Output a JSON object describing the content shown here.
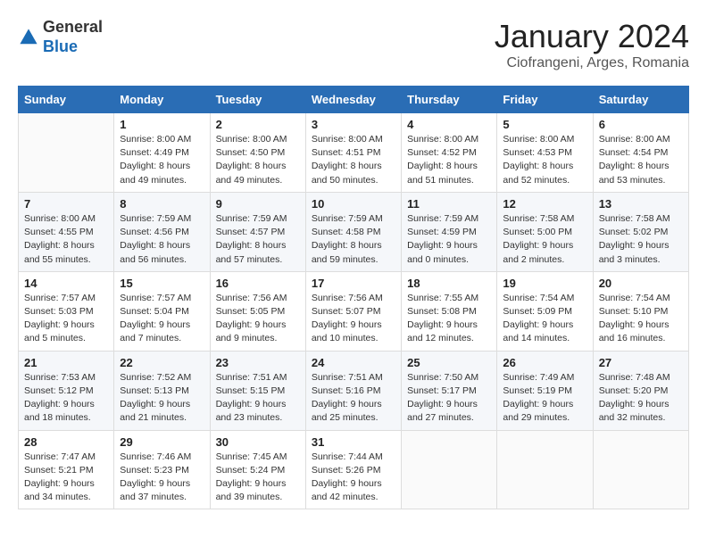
{
  "header": {
    "logo": {
      "general": "General",
      "blue": "Blue"
    },
    "title": "January 2024",
    "subtitle": "Ciofrangeni, Arges, Romania"
  },
  "days_of_week": [
    "Sunday",
    "Monday",
    "Tuesday",
    "Wednesday",
    "Thursday",
    "Friday",
    "Saturday"
  ],
  "weeks": [
    [
      {
        "day": "",
        "info": ""
      },
      {
        "day": "1",
        "info": "Sunrise: 8:00 AM\nSunset: 4:49 PM\nDaylight: 8 hours\nand 49 minutes."
      },
      {
        "day": "2",
        "info": "Sunrise: 8:00 AM\nSunset: 4:50 PM\nDaylight: 8 hours\nand 49 minutes."
      },
      {
        "day": "3",
        "info": "Sunrise: 8:00 AM\nSunset: 4:51 PM\nDaylight: 8 hours\nand 50 minutes."
      },
      {
        "day": "4",
        "info": "Sunrise: 8:00 AM\nSunset: 4:52 PM\nDaylight: 8 hours\nand 51 minutes."
      },
      {
        "day": "5",
        "info": "Sunrise: 8:00 AM\nSunset: 4:53 PM\nDaylight: 8 hours\nand 52 minutes."
      },
      {
        "day": "6",
        "info": "Sunrise: 8:00 AM\nSunset: 4:54 PM\nDaylight: 8 hours\nand 53 minutes."
      }
    ],
    [
      {
        "day": "7",
        "info": "Sunrise: 8:00 AM\nSunset: 4:55 PM\nDaylight: 8 hours\nand 55 minutes."
      },
      {
        "day": "8",
        "info": "Sunrise: 7:59 AM\nSunset: 4:56 PM\nDaylight: 8 hours\nand 56 minutes."
      },
      {
        "day": "9",
        "info": "Sunrise: 7:59 AM\nSunset: 4:57 PM\nDaylight: 8 hours\nand 57 minutes."
      },
      {
        "day": "10",
        "info": "Sunrise: 7:59 AM\nSunset: 4:58 PM\nDaylight: 8 hours\nand 59 minutes."
      },
      {
        "day": "11",
        "info": "Sunrise: 7:59 AM\nSunset: 4:59 PM\nDaylight: 9 hours\nand 0 minutes."
      },
      {
        "day": "12",
        "info": "Sunrise: 7:58 AM\nSunset: 5:00 PM\nDaylight: 9 hours\nand 2 minutes."
      },
      {
        "day": "13",
        "info": "Sunrise: 7:58 AM\nSunset: 5:02 PM\nDaylight: 9 hours\nand 3 minutes."
      }
    ],
    [
      {
        "day": "14",
        "info": "Sunrise: 7:57 AM\nSunset: 5:03 PM\nDaylight: 9 hours\nand 5 minutes."
      },
      {
        "day": "15",
        "info": "Sunrise: 7:57 AM\nSunset: 5:04 PM\nDaylight: 9 hours\nand 7 minutes."
      },
      {
        "day": "16",
        "info": "Sunrise: 7:56 AM\nSunset: 5:05 PM\nDaylight: 9 hours\nand 9 minutes."
      },
      {
        "day": "17",
        "info": "Sunrise: 7:56 AM\nSunset: 5:07 PM\nDaylight: 9 hours\nand 10 minutes."
      },
      {
        "day": "18",
        "info": "Sunrise: 7:55 AM\nSunset: 5:08 PM\nDaylight: 9 hours\nand 12 minutes."
      },
      {
        "day": "19",
        "info": "Sunrise: 7:54 AM\nSunset: 5:09 PM\nDaylight: 9 hours\nand 14 minutes."
      },
      {
        "day": "20",
        "info": "Sunrise: 7:54 AM\nSunset: 5:10 PM\nDaylight: 9 hours\nand 16 minutes."
      }
    ],
    [
      {
        "day": "21",
        "info": "Sunrise: 7:53 AM\nSunset: 5:12 PM\nDaylight: 9 hours\nand 18 minutes."
      },
      {
        "day": "22",
        "info": "Sunrise: 7:52 AM\nSunset: 5:13 PM\nDaylight: 9 hours\nand 21 minutes."
      },
      {
        "day": "23",
        "info": "Sunrise: 7:51 AM\nSunset: 5:15 PM\nDaylight: 9 hours\nand 23 minutes."
      },
      {
        "day": "24",
        "info": "Sunrise: 7:51 AM\nSunset: 5:16 PM\nDaylight: 9 hours\nand 25 minutes."
      },
      {
        "day": "25",
        "info": "Sunrise: 7:50 AM\nSunset: 5:17 PM\nDaylight: 9 hours\nand 27 minutes."
      },
      {
        "day": "26",
        "info": "Sunrise: 7:49 AM\nSunset: 5:19 PM\nDaylight: 9 hours\nand 29 minutes."
      },
      {
        "day": "27",
        "info": "Sunrise: 7:48 AM\nSunset: 5:20 PM\nDaylight: 9 hours\nand 32 minutes."
      }
    ],
    [
      {
        "day": "28",
        "info": "Sunrise: 7:47 AM\nSunset: 5:21 PM\nDaylight: 9 hours\nand 34 minutes."
      },
      {
        "day": "29",
        "info": "Sunrise: 7:46 AM\nSunset: 5:23 PM\nDaylight: 9 hours\nand 37 minutes."
      },
      {
        "day": "30",
        "info": "Sunrise: 7:45 AM\nSunset: 5:24 PM\nDaylight: 9 hours\nand 39 minutes."
      },
      {
        "day": "31",
        "info": "Sunrise: 7:44 AM\nSunset: 5:26 PM\nDaylight: 9 hours\nand 42 minutes."
      },
      {
        "day": "",
        "info": ""
      },
      {
        "day": "",
        "info": ""
      },
      {
        "day": "",
        "info": ""
      }
    ]
  ]
}
